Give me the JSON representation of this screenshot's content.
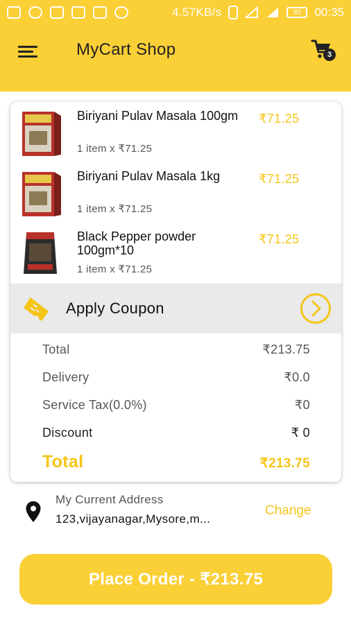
{
  "status_bar": {
    "speed": "4.57KB/s",
    "battery": "85",
    "time": "00:35"
  },
  "header": {
    "title": "MyCart Shop",
    "cart_count": "3",
    "accent_color": "#fbcf36"
  },
  "cart": {
    "items": [
      {
        "name": "Biriyani Pulav Masala 100gm",
        "quantity": "1 item x ₹71.25",
        "price": "₹71.25"
      },
      {
        "name": "Biriyani Pulav Masala 1kg",
        "quantity": "1 item x ₹71.25",
        "price": "₹71.25"
      },
      {
        "name": "Black Pepper powder 100gm*10",
        "quantity": "1 item x ₹71.25",
        "price": "₹71.25"
      }
    ]
  },
  "coupon": {
    "label": "Apply Coupon"
  },
  "summary": {
    "total_label": "Total",
    "total_value": "₹213.75",
    "delivery_label": "Delivery",
    "delivery_value": "₹0.0",
    "tax_label": "Service Tax(0.0%)",
    "tax_value": "₹0",
    "discount_label": "Discount",
    "discount_value": "₹ 0",
    "grand_total_label": "Total",
    "grand_total_value": "₹213.75"
  },
  "address": {
    "label": "My Current Address",
    "value": "123,vijayanagar,Mysore,m...",
    "change_label": "Change"
  },
  "place_order": {
    "label": "Place Order - ₹213.75"
  }
}
